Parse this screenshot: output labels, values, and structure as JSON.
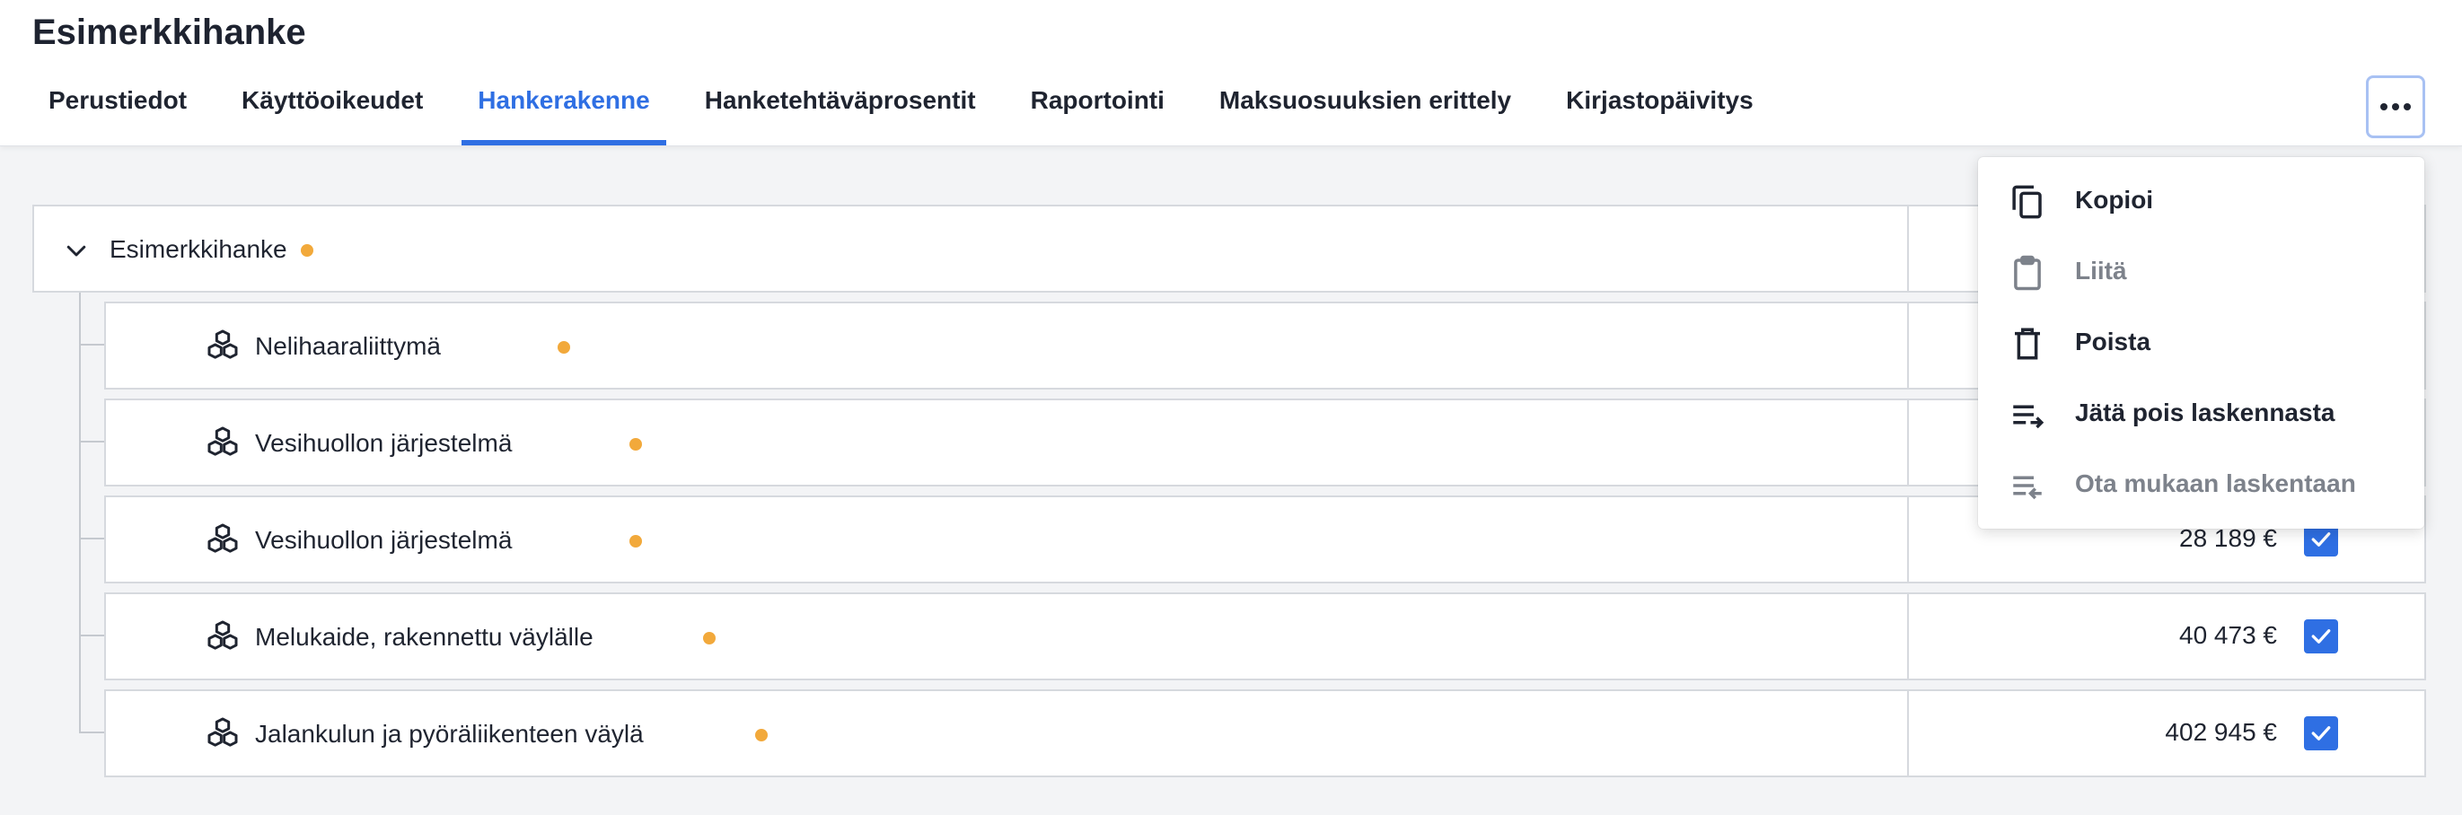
{
  "app": {
    "title": "Esimerkkihanke"
  },
  "tabs": [
    {
      "label": "Perustiedot",
      "active": false
    },
    {
      "label": "Käyttöoikeudet",
      "active": false
    },
    {
      "label": "Hankerakenne",
      "active": true
    },
    {
      "label": "Hanketehtäväprosentit",
      "active": false
    },
    {
      "label": "Raportointi",
      "active": false
    },
    {
      "label": "Maksuosuuksien erittely",
      "active": false
    },
    {
      "label": "Kirjastopäivitys",
      "active": false
    }
  ],
  "more_button": {
    "icon": "more-horizontal-icon"
  },
  "tree": {
    "root": {
      "label": "Esimerkkihanke",
      "status_color": "#f2a93b",
      "expanded": true
    },
    "children": [
      {
        "label": "Nelihaaraliittymä",
        "amount": "",
        "checked": true
      },
      {
        "label": "Vesihuollon järjestelmä",
        "amount": "",
        "checked": true
      },
      {
        "label": "Vesihuollon järjestelmä",
        "amount": "28 189 €",
        "checked": true
      },
      {
        "label": "Melukaide, rakennettu väylälle",
        "amount": "40 473 €",
        "checked": true
      },
      {
        "label": "Jalankulun ja pyöräliikenteen väylä",
        "amount": "402 945 €",
        "checked": true
      }
    ]
  },
  "context_menu": {
    "items": [
      {
        "label": "Kopioi",
        "icon": "copy-icon",
        "enabled": true
      },
      {
        "label": "Liitä",
        "icon": "clipboard-icon",
        "enabled": false
      },
      {
        "label": "Poista",
        "icon": "trash-icon",
        "enabled": true
      },
      {
        "label": "Jätä pois laskennasta",
        "icon": "exclude-from-calculation-icon",
        "enabled": true
      },
      {
        "label": "Ota mukaan laskentaan",
        "icon": "include-in-calculation-icon",
        "enabled": false
      }
    ]
  },
  "colors": {
    "accent": "#2f6fe3",
    "status_dot": "#f2a93b",
    "disabled_text": "#7d828b"
  }
}
